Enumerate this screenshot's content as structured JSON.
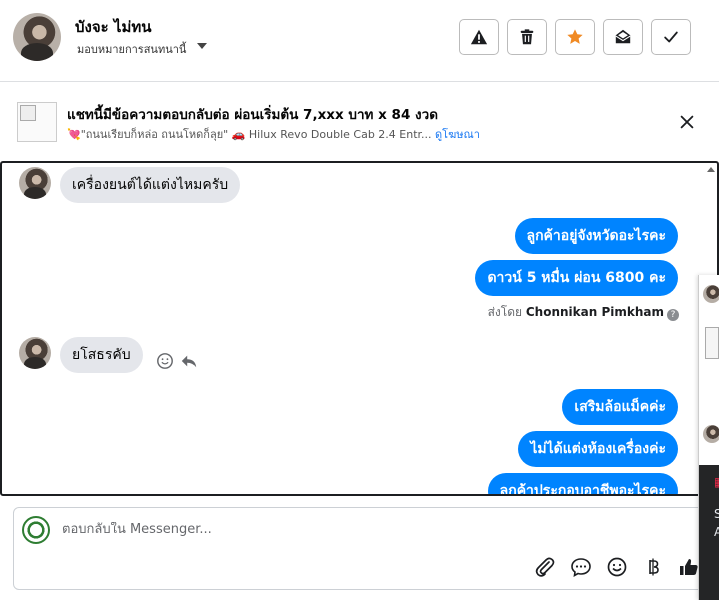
{
  "header": {
    "name": "บังจะ ไม่ทน",
    "assign_label": "มอบหมายการสนทนานี้"
  },
  "ad": {
    "title": "แชทนี้มีข้อความตอบกลับต่อ ผ่อนเริ่มต้น 7,xxx บาท x 84 งวด",
    "subtitle": "💘\"ถนนเรียบก็หล่อ ถนนโหดก็ลุย\" 🚗 Hilux Revo Double Cab 2.4 Entr...",
    "link": "ดูโฆษณา"
  },
  "messages": [
    {
      "from": "customer",
      "text": "เครื่องยนต์ได้แต่งไหมครับ"
    },
    {
      "from": "page",
      "text": "ลูกค้าอยู่จังหวัดอะไรคะ"
    },
    {
      "from": "page",
      "text": "ดาวน์ 5 หมื่น ผ่อน 6800 คะ"
    },
    {
      "from": "customer",
      "text": "ยโสธรคับ"
    },
    {
      "from": "page",
      "text": "เสริมล้อแม็คค่ะ"
    },
    {
      "from": "page",
      "text": "ไม่ได้แต่งห้องเครื่องค่ะ"
    },
    {
      "from": "page",
      "text": "ลูกค้าประกอบอาชีพอะไรคะ"
    }
  ],
  "sent_by": {
    "prefix": "ส่งโดย",
    "agent": "Chonnikan Pimkham"
  },
  "composer": {
    "placeholder": "ตอบกลับใน Messenger..."
  },
  "overlay_text": {
    "line1": "S",
    "line2": "A"
  },
  "colors": {
    "outgoing_bubble": "#0084ff",
    "incoming_bubble": "#e4e6eb",
    "star": "#f08a24",
    "link": "#1877f2"
  }
}
